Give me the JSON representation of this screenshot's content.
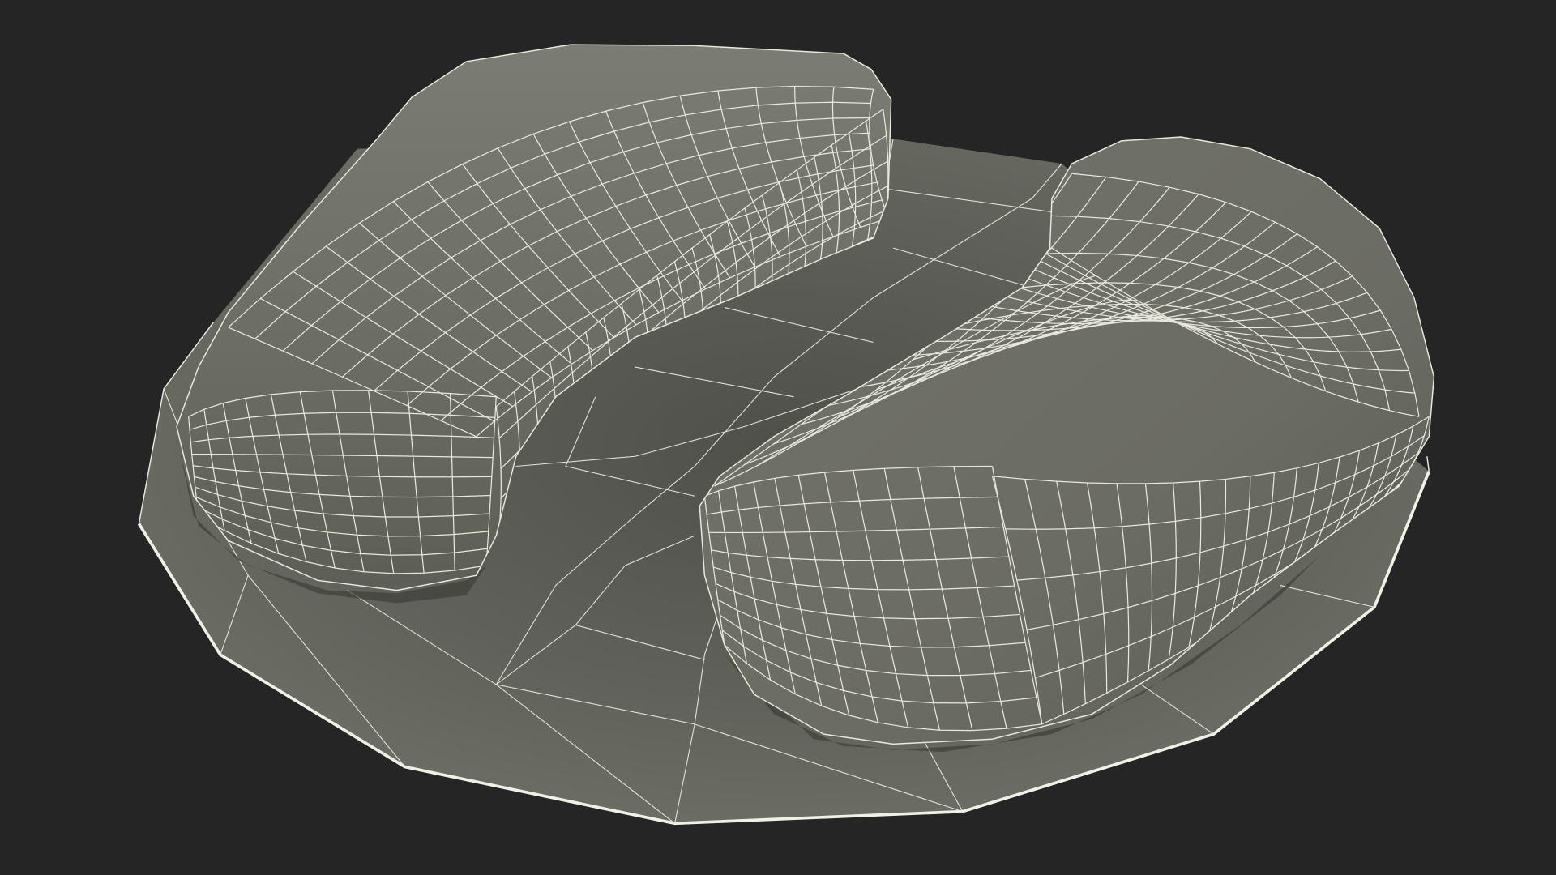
{
  "scene": {
    "subject": "wireframe-render",
    "colors": {
      "background": "#252525",
      "surface": "#6b6c63",
      "surface_dark": "#55564f",
      "surface_light": "#777870",
      "wire": "#e8e8dc",
      "edge_highlight": "#f0f0e4"
    }
  }
}
